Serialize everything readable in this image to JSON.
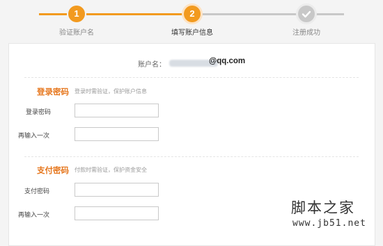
{
  "colors": {
    "accent": "#f29a1f",
    "inactive": "#c8c8c8",
    "section_title": "#e6771e"
  },
  "steps": [
    {
      "number": "1",
      "label": "验证账户名",
      "state": "done"
    },
    {
      "number": "2",
      "label": "填写账户信息",
      "state": "current"
    },
    {
      "icon": "check-icon",
      "label": "注册成功",
      "state": "pending"
    }
  ],
  "account": {
    "label": "账户名：",
    "suffix": "@qq.com"
  },
  "login_section": {
    "title": "登录密码",
    "hint": "登录时需验证，保护账户信息",
    "fields": [
      {
        "label": "登录密码",
        "value": ""
      },
      {
        "label": "再输入一次",
        "value": ""
      }
    ]
  },
  "pay_section": {
    "title": "支付密码",
    "hint": "付款时需验证，保护资金安全",
    "fields": [
      {
        "label": "支付密码",
        "value": ""
      },
      {
        "label": "再输入一次",
        "value": ""
      }
    ]
  },
  "watermark": {
    "cn": "脚本之家",
    "url": "www.jb51.net"
  }
}
